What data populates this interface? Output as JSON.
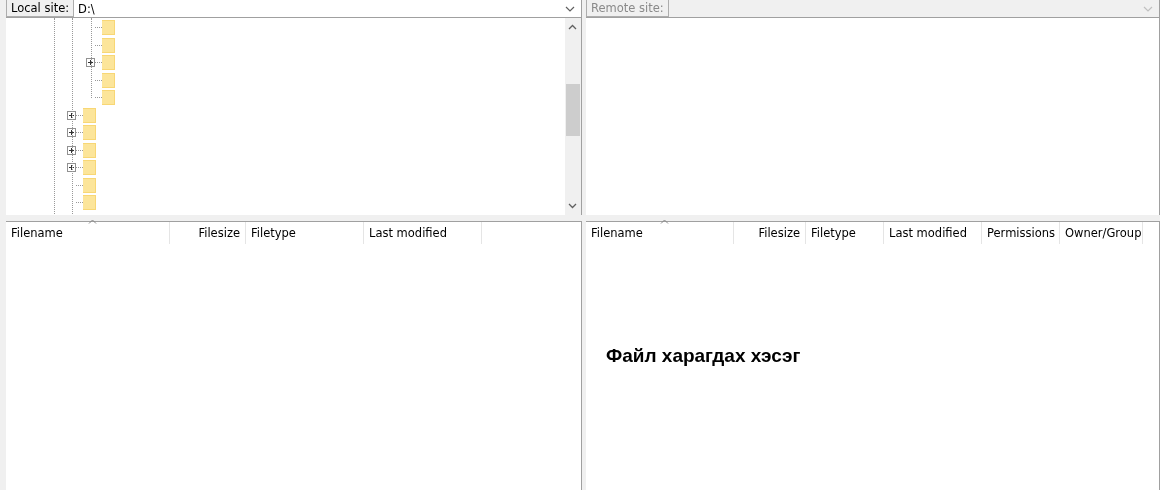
{
  "local_site": {
    "label": "Local site:",
    "value": "D:\\",
    "disabled": false
  },
  "remote_site": {
    "label": "Remote site:",
    "disabled": true
  },
  "local_tree": {
    "nested_items": [
      {
        "expandable": false
      },
      {
        "expandable": false
      },
      {
        "expandable": true
      },
      {
        "expandable": false
      },
      {
        "expandable": false
      }
    ],
    "items": [
      {
        "expandable": true
      },
      {
        "expandable": true
      },
      {
        "expandable": true
      },
      {
        "expandable": true
      },
      {
        "expandable": false
      },
      {
        "expandable": false
      }
    ]
  },
  "local_list": {
    "columns": [
      {
        "label": "Filename",
        "kind": "text",
        "sorted": true
      },
      {
        "label": "Filesize",
        "kind": "number",
        "sorted": false
      },
      {
        "label": "Filetype",
        "kind": "text",
        "sorted": false
      },
      {
        "label": "Last modified",
        "kind": "text",
        "sorted": false
      }
    ]
  },
  "remote_list": {
    "columns": [
      {
        "label": "Filename",
        "kind": "text",
        "sorted": true
      },
      {
        "label": "Filesize",
        "kind": "number",
        "sorted": false
      },
      {
        "label": "Filetype",
        "kind": "text",
        "sorted": false
      },
      {
        "label": "Last modified",
        "kind": "text",
        "sorted": false
      },
      {
        "label": "Permissions",
        "kind": "text",
        "sorted": false
      },
      {
        "label": "Owner/Group",
        "kind": "text",
        "sorted": false
      }
    ],
    "caption": "Файл харагдах хэсэг"
  }
}
